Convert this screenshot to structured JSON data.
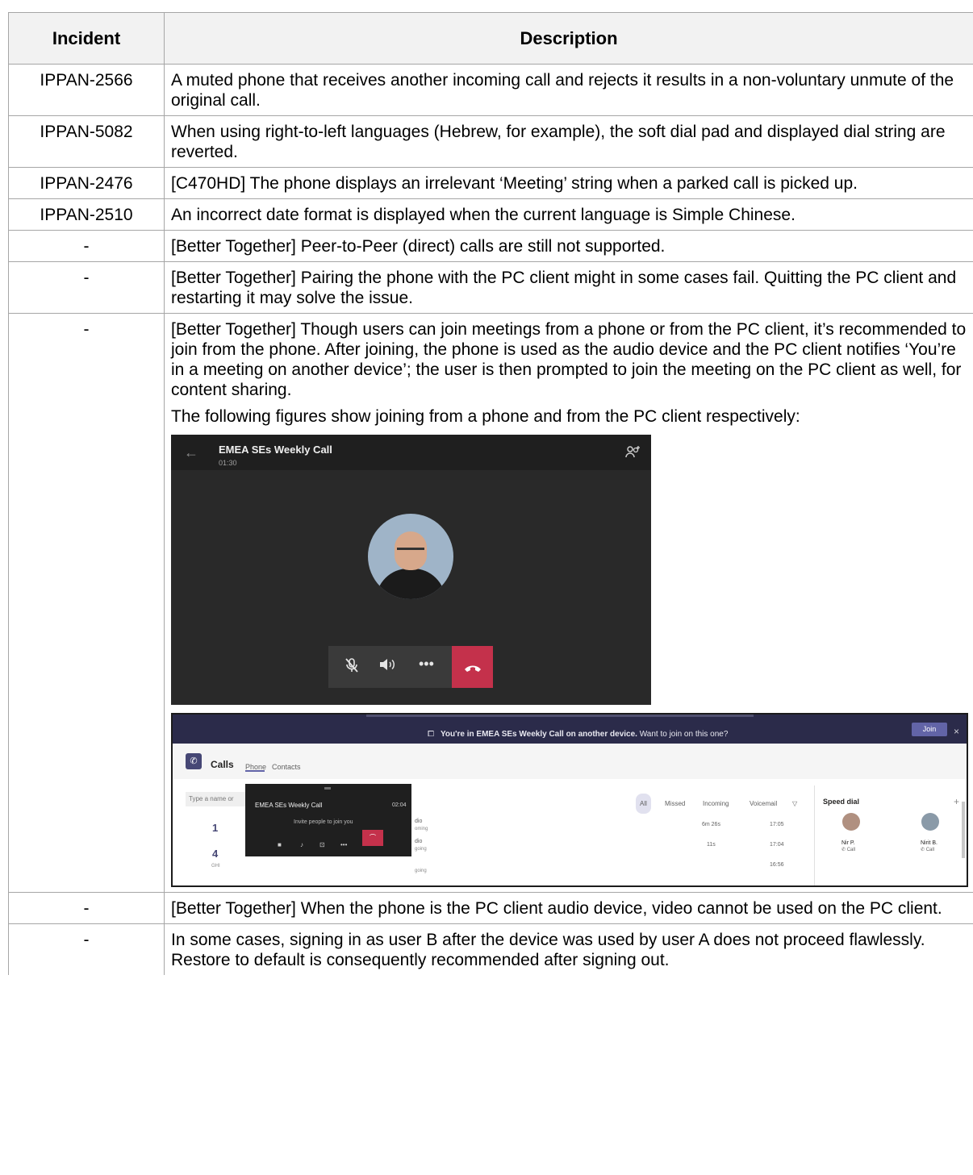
{
  "table": {
    "headers": {
      "incident": "Incident",
      "description": "Description"
    },
    "rows": [
      {
        "incident": "IPPAN-2566",
        "description": [
          "A muted phone that receives another incoming call and rejects it results in a non-voluntary unmute of the original call."
        ]
      },
      {
        "incident": "IPPAN-5082",
        "description": [
          "When using right-to-left languages (Hebrew, for example), the soft dial pad and displayed dial string are reverted."
        ]
      },
      {
        "incident": "IPPAN-2476",
        "description": [
          "[C470HD] The phone displays an irrelevant ‘Meeting’ string when a parked call is picked up."
        ]
      },
      {
        "incident": "IPPAN-2510",
        "description": [
          "An incorrect date format is displayed when the current language is Simple Chinese."
        ]
      },
      {
        "incident": "-",
        "description": [
          "[Better Together] Peer-to-Peer (direct) calls are still not supported."
        ]
      },
      {
        "incident": "-",
        "description": [
          "[Better Together] Pairing the phone with the PC client might in some cases fail. Quitting the PC client and restarting it may solve the issue."
        ]
      },
      {
        "incident": "-",
        "description": [
          "[Better Together] Though users can join meetings from a phone or from the PC client, it’s recommended to join from the phone. After joining, the phone is used as the audio device and the PC client notifies ‘You’re in a meeting on another device’; the user is then prompted to join the meeting on the PC client as well, for content sharing.",
          "The following figures show joining from a phone and from the PC client respectively:"
        ]
      },
      {
        "incident": "-",
        "description": [
          "[Better Together] When the phone is the PC client audio device, video cannot be used on the PC client."
        ]
      },
      {
        "incident": "-",
        "description": [
          "In some cases, signing in as user B after the device was used by user A does not proceed flawlessly. Restore to default is consequently recommended after signing out."
        ]
      }
    ]
  },
  "phone_meeting": {
    "title": "EMEA SEs Weekly Call",
    "timer": "01:30",
    "icons": [
      "back-arrow-icon",
      "people-icon",
      "mic-off-icon",
      "speaker-icon",
      "more-icon",
      "hang-up-icon"
    ]
  },
  "pc_client": {
    "banner_bold": "You're in EMEA SEs Weekly Call on another device.",
    "banner_rest": "Want to join on this one?",
    "join_label": "Join",
    "calls_title": "Calls",
    "tabs": [
      "Phone",
      "Contacts"
    ],
    "search_placeholder": "Type a name or",
    "dial_numbers": [
      "1",
      "4"
    ],
    "dial_sub": "GHI",
    "filters": [
      "All",
      "Missed",
      "Incoming",
      "Voicemail"
    ],
    "history": [
      {
        "label": "dio",
        "sub": "oming",
        "duration": "6m 26s",
        "time": "17:05"
      },
      {
        "label": "dio",
        "sub": "going",
        "duration": "11s",
        "time": "17:04"
      },
      {
        "label": "",
        "sub": "going",
        "duration": "",
        "time": "16:56"
      }
    ],
    "speed_dial_title": "Speed dial",
    "speed_dial": [
      {
        "name": "Nir P.",
        "action": "Call"
      },
      {
        "name": "Nirit B.",
        "action": "Call"
      }
    ],
    "mini_call": {
      "title": "EMEA SEs Weekly Call",
      "timer": "02:04",
      "invite": "Invite people to join you"
    }
  }
}
